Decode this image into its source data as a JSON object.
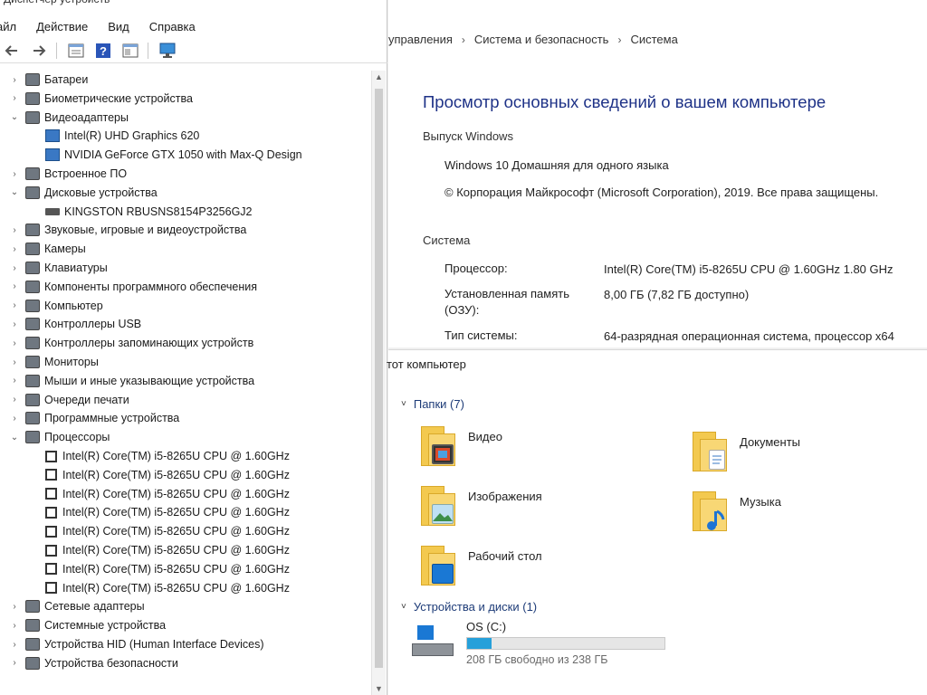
{
  "device_manager": {
    "title": "Диспетчер устройств",
    "menu": [
      "айл",
      "Действие",
      "Вид",
      "Справка"
    ],
    "toolbar_icons": [
      "back-arrow-icon",
      "forward-arrow-icon",
      "properties-icon",
      "help-icon",
      "console-icon",
      "monitor-icon"
    ],
    "tree": [
      {
        "label": "Батареи",
        "level": 0,
        "state": "collapsed",
        "icon": "battery-icon"
      },
      {
        "label": "Биометрические устройства",
        "level": 0,
        "state": "collapsed",
        "icon": "biometric-icon"
      },
      {
        "label": "Видеоадаптеры",
        "level": 0,
        "state": "expanded",
        "icon": "display-adapter-icon"
      },
      {
        "label": "Intel(R) UHD Graphics 620",
        "level": 1,
        "icon": "gpu-icon"
      },
      {
        "label": "NVIDIA GeForce GTX 1050 with Max-Q Design",
        "level": 1,
        "icon": "gpu-icon"
      },
      {
        "label": "Встроенное ПО",
        "level": 0,
        "state": "collapsed",
        "icon": "firmware-icon"
      },
      {
        "label": "Дисковые устройства",
        "level": 0,
        "state": "expanded",
        "icon": "disk-drive-icon"
      },
      {
        "label": "KINGSTON RBUSNS8154P3256GJ2",
        "level": 1,
        "icon": "disk-icon"
      },
      {
        "label": "Звуковые, игровые и видеоустройства",
        "level": 0,
        "state": "collapsed",
        "icon": "sound-icon"
      },
      {
        "label": "Камеры",
        "level": 0,
        "state": "collapsed",
        "icon": "camera-icon"
      },
      {
        "label": "Клавиатуры",
        "level": 0,
        "state": "collapsed",
        "icon": "keyboard-icon"
      },
      {
        "label": "Компоненты программного обеспечения",
        "level": 0,
        "state": "collapsed",
        "icon": "software-component-icon"
      },
      {
        "label": "Компьютер",
        "level": 0,
        "state": "collapsed",
        "icon": "computer-icon"
      },
      {
        "label": "Контроллеры USB",
        "level": 0,
        "state": "collapsed",
        "icon": "usb-icon"
      },
      {
        "label": "Контроллеры запоминающих устройств",
        "level": 0,
        "state": "collapsed",
        "icon": "storage-controller-icon"
      },
      {
        "label": "Мониторы",
        "level": 0,
        "state": "collapsed",
        "icon": "monitor-icon"
      },
      {
        "label": "Мыши и иные указывающие устройства",
        "level": 0,
        "state": "collapsed",
        "icon": "mouse-icon"
      },
      {
        "label": "Очереди печати",
        "level": 0,
        "state": "collapsed",
        "icon": "printer-icon"
      },
      {
        "label": "Программные устройства",
        "level": 0,
        "state": "collapsed",
        "icon": "software-device-icon"
      },
      {
        "label": "Процессоры",
        "level": 0,
        "state": "expanded",
        "icon": "processor-icon"
      },
      {
        "label": "Intel(R) Core(TM) i5-8265U CPU @ 1.60GHz",
        "level": 1,
        "icon": "cpu-icon"
      },
      {
        "label": "Intel(R) Core(TM) i5-8265U CPU @ 1.60GHz",
        "level": 1,
        "icon": "cpu-icon"
      },
      {
        "label": "Intel(R) Core(TM) i5-8265U CPU @ 1.60GHz",
        "level": 1,
        "icon": "cpu-icon"
      },
      {
        "label": "Intel(R) Core(TM) i5-8265U CPU @ 1.60GHz",
        "level": 1,
        "icon": "cpu-icon"
      },
      {
        "label": "Intel(R) Core(TM) i5-8265U CPU @ 1.60GHz",
        "level": 1,
        "icon": "cpu-icon"
      },
      {
        "label": "Intel(R) Core(TM) i5-8265U CPU @ 1.60GHz",
        "level": 1,
        "icon": "cpu-icon"
      },
      {
        "label": "Intel(R) Core(TM) i5-8265U CPU @ 1.60GHz",
        "level": 1,
        "icon": "cpu-icon"
      },
      {
        "label": "Intel(R) Core(TM) i5-8265U CPU @ 1.60GHz",
        "level": 1,
        "icon": "cpu-icon"
      },
      {
        "label": "Сетевые адаптеры",
        "level": 0,
        "state": "collapsed",
        "icon": "network-adapter-icon"
      },
      {
        "label": "Системные устройства",
        "level": 0,
        "state": "collapsed",
        "icon": "system-device-icon"
      },
      {
        "label": "Устройства HID (Human Interface Devices)",
        "level": 0,
        "state": "collapsed",
        "icon": "hid-icon"
      },
      {
        "label": "Устройства безопасности",
        "level": 0,
        "state": "collapsed",
        "icon": "security-device-icon"
      }
    ]
  },
  "system": {
    "breadcrumb": [
      "управления",
      "Система и безопасность",
      "Система"
    ],
    "heading": "Просмотр основных сведений о вашем компьютере",
    "edition_title": "Выпуск Windows",
    "edition": "Windows 10 Домашняя для одного языка",
    "copyright": "© Корпорация Майкрософт (Microsoft Corporation), 2019. Все права защищены.",
    "system_title": "Система",
    "processor_label": "Процессор:",
    "processor_value": "Intel(R) Core(TM) i5-8265U CPU @ 1.60GHz   1.80 GHz",
    "memory_label_1": "Установленная память",
    "memory_label_2": "(ОЗУ):",
    "memory_value": "8,00 ГБ (7,82 ГБ доступно)",
    "type_label": "Тип системы:",
    "type_value": "64-разрядная операционная система, процессор x64"
  },
  "explorer": {
    "title": "тот компьютер",
    "folders_header": "Папки (7)",
    "folders": [
      {
        "label": "Видео",
        "icon": "videos-folder-icon"
      },
      {
        "label": "Документы",
        "icon": "documents-folder-icon"
      },
      {
        "label": "Изображения",
        "icon": "pictures-folder-icon"
      },
      {
        "label": "Музыка",
        "icon": "music-folder-icon"
      },
      {
        "label": "Рабочий стол",
        "icon": "desktop-folder-icon"
      }
    ],
    "devices_header": "Устройства и диски (1)",
    "drive": {
      "name": "OS (C:)",
      "free_text": "208 ГБ свободно из 238 ГБ",
      "used_fraction": 0.126,
      "fill_color": "#26a0da"
    }
  }
}
